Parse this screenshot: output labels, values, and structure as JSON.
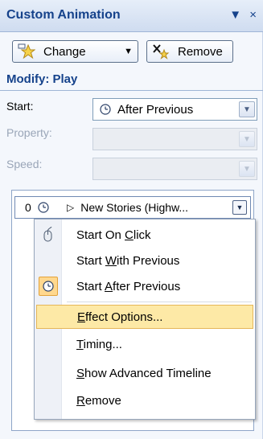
{
  "pane": {
    "title": "Custom Animation",
    "dropdown_glyph": "▼",
    "close_glyph": "×"
  },
  "toolbar": {
    "change_label": "Change",
    "remove_label": "Remove"
  },
  "modify": {
    "header": "Modify: Play",
    "start_label": "Start:",
    "start_value": "After Previous",
    "property_label": "Property:",
    "speed_label": "Speed:"
  },
  "list": {
    "items": [
      {
        "order": "0",
        "name": "New Stories (Highw..."
      }
    ]
  },
  "menu": {
    "items": [
      {
        "label_pre": "Start On ",
        "label_key": "C",
        "label_post": "lick"
      },
      {
        "label_pre": "Start ",
        "label_key": "W",
        "label_post": "ith Previous"
      },
      {
        "label_pre": "Start ",
        "label_key": "A",
        "label_post": "fter Previous"
      },
      {
        "label_pre": "",
        "label_key": "E",
        "label_post": "ffect Options..."
      },
      {
        "label_pre": "",
        "label_key": "T",
        "label_post": "iming..."
      },
      {
        "label_pre": "",
        "label_key": "S",
        "label_post": "how Advanced Timeline"
      },
      {
        "label_pre": "",
        "label_key": "R",
        "label_post": "emove"
      }
    ]
  },
  "colors": {
    "accent": "#15428b",
    "highlight": "#fde9a6"
  }
}
